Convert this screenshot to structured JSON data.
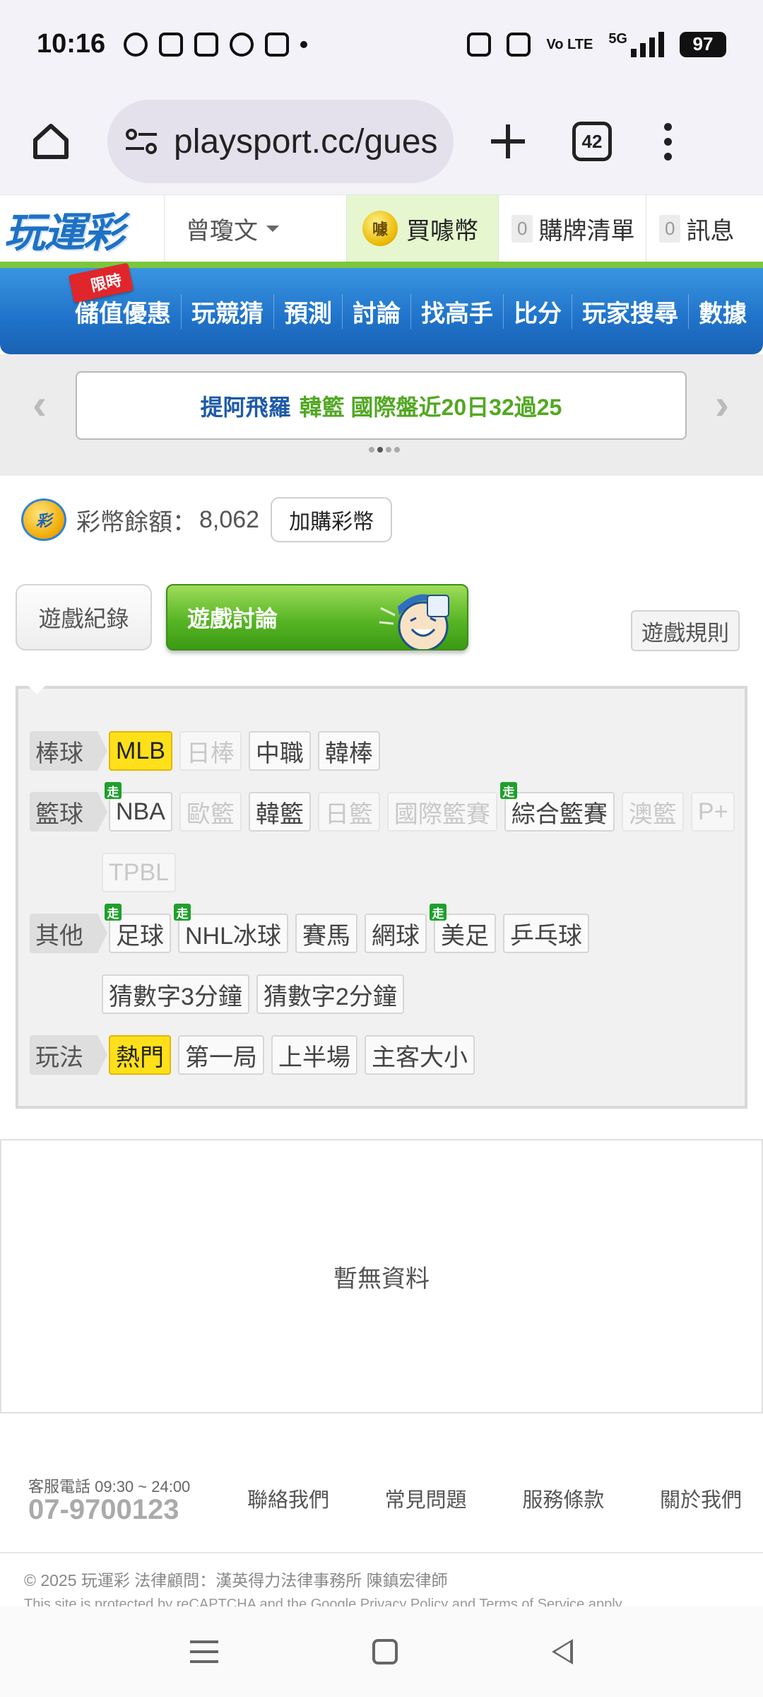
{
  "status_bar": {
    "time": "10:16",
    "volte": "Vo LTE",
    "network": "5G",
    "battery": "97"
  },
  "browser": {
    "url": "playsport.cc/gues",
    "tab_count": "42"
  },
  "header": {
    "logo": "玩運彩",
    "user": "曾瓊文",
    "buy_coins": "買噱幣",
    "buy_coin_badge": "噱",
    "cart_count": "0",
    "cart_label": "購牌清單",
    "msg_count": "0",
    "msg_label": "訊息"
  },
  "nav": {
    "limited_tag": "限時",
    "items": [
      "儲值優惠",
      "玩競猜",
      "預測",
      "討論",
      "找高手",
      "比分",
      "玩家搜尋",
      "數據"
    ]
  },
  "ticker": {
    "name": "提阿飛羅",
    "text": "韓籃 國際盤近20日32過25"
  },
  "balance": {
    "label": "彩幣餘額：",
    "value": "8,062",
    "buy_button": "加購彩幣",
    "coin_badge": "彩"
  },
  "game_tabs": {
    "record": "遊戲紀錄",
    "discuss": "遊戲討論",
    "rules": "遊戲規則"
  },
  "filters": {
    "baseball_label": "棒球",
    "baseball": [
      {
        "label": "MLB",
        "state": "selected"
      },
      {
        "label": "日棒",
        "state": "disabled"
      },
      {
        "label": "中職",
        "state": "normal"
      },
      {
        "label": "韓棒",
        "state": "normal"
      }
    ],
    "basketball_label": "籃球",
    "basketball": [
      {
        "label": "NBA",
        "state": "normal",
        "live": true
      },
      {
        "label": "歐籃",
        "state": "disabled"
      },
      {
        "label": "韓籃",
        "state": "normal"
      },
      {
        "label": "日籃",
        "state": "disabled"
      },
      {
        "label": "國際籃賽",
        "state": "disabled"
      },
      {
        "label": "綜合籃賽",
        "state": "normal",
        "live": true
      },
      {
        "label": "澳籃",
        "state": "disabled"
      },
      {
        "label": "P+",
        "state": "disabled"
      },
      {
        "label": "TPBL",
        "state": "disabled"
      }
    ],
    "other_label": "其他",
    "other": [
      {
        "label": "足球",
        "state": "normal",
        "live": true
      },
      {
        "label": "NHL冰球",
        "state": "normal",
        "live": true
      },
      {
        "label": "賽馬",
        "state": "normal"
      },
      {
        "label": "網球",
        "state": "normal"
      },
      {
        "label": "美足",
        "state": "normal",
        "live": true
      },
      {
        "label": "乒乓球",
        "state": "normal"
      },
      {
        "label": "猜數字3分鐘",
        "state": "normal"
      },
      {
        "label": "猜數字2分鐘",
        "state": "normal"
      }
    ],
    "play_label": "玩法",
    "play": [
      {
        "label": "熱門",
        "state": "selected"
      },
      {
        "label": "第一局",
        "state": "normal"
      },
      {
        "label": "上半場",
        "state": "normal"
      },
      {
        "label": "主客大小",
        "state": "normal"
      }
    ],
    "live_badge": "走"
  },
  "empty_state": "暫無資料",
  "footer": {
    "phone_label": "客服電話 09:30 ~ 24:00",
    "phone": "07-9700123",
    "links": [
      "聯絡我們",
      "常見問題",
      "服務條款",
      "關於我們"
    ],
    "copyright": "© 2025 玩運彩 法律顧問：漢英得力法律事務所 陳鎮宏律師",
    "recaptcha": "This site is protected by reCAPTCHA and the Google Privacy Policy and Terms of Service apply."
  }
}
